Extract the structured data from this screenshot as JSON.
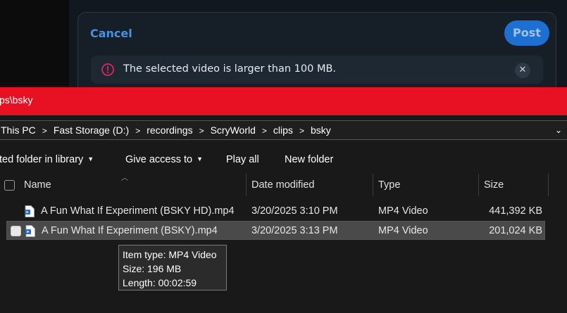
{
  "dialog": {
    "cancel_label": "Cancel",
    "post_label": "Post",
    "alert": {
      "message": "The selected video is larger than 100 MB.",
      "icon": "alert-circle-icon",
      "close_icon": "close-icon"
    },
    "colors": {
      "accent": "#1d6fd2",
      "cancel": "#4a90e2",
      "alert_icon": "#e0245e"
    }
  },
  "explorer": {
    "title": "ps\\bsky",
    "title_color": "#e81123",
    "breadcrumb": [
      "This PC",
      "Fast Storage (D:)",
      "recordings",
      "ScryWorld",
      "clips",
      "bsky"
    ],
    "toolbar": {
      "include_label": "ted folder in library",
      "give_access_label": "Give access to",
      "play_all_label": "Play all",
      "new_folder_label": "New folder"
    },
    "columns": {
      "name": "Name",
      "date": "Date modified",
      "type": "Type",
      "size": "Size"
    },
    "files": [
      {
        "name": "A Fun What If Experiment (BSKY HD).mp4",
        "date": "3/20/2025 3:10 PM",
        "type": "MP4 Video",
        "size": "441,392 KB",
        "selected": false
      },
      {
        "name": "A Fun What If Experiment (BSKY).mp4",
        "date": "3/20/2025 3:13 PM",
        "type": "MP4 Video",
        "size": "201,024 KB",
        "selected": true
      }
    ],
    "tooltip": {
      "line1": "Item type: MP4 Video",
      "line2": "Size: 196 MB",
      "line3": "Length: 00:02:59"
    }
  }
}
